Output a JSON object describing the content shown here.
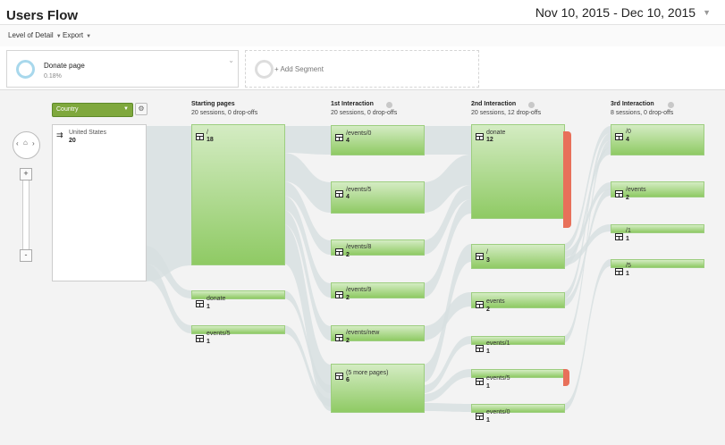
{
  "title": "Users Flow",
  "date_range": {
    "start": "Nov 10, 2015",
    "sep": " - ",
    "end": "Dec 10, 2015"
  },
  "toolbar": {
    "level_of_detail": "Level of Detail",
    "export": "Export"
  },
  "segments": {
    "segment1": {
      "name": "Donate page",
      "percent": "0.18%"
    },
    "add_segment": "+ Add Segment"
  },
  "dimension": {
    "selected": "Country"
  },
  "country_node": {
    "label": "United States",
    "count": "20"
  },
  "columns": [
    {
      "title": "Starting pages",
      "sub": "20 sessions, 0 drop-offs"
    },
    {
      "title": "1st Interaction",
      "sub": "20 sessions, 0 drop-offs"
    },
    {
      "title": "2nd Interaction",
      "sub": "20 sessions, 12 drop-offs"
    },
    {
      "title": "3rd Interaction",
      "sub": "8 sessions, 0 drop-offs"
    }
  ],
  "nodes": {
    "start": [
      {
        "label": "/",
        "count": "18"
      },
      {
        "label": "donate",
        "count": "1"
      },
      {
        "label": "events/5",
        "count": "1"
      }
    ],
    "first": [
      {
        "label": "/events/0",
        "count": "4"
      },
      {
        "label": "/events/5",
        "count": "4"
      },
      {
        "label": "/events/8",
        "count": "2"
      },
      {
        "label": "/events/9",
        "count": "2"
      },
      {
        "label": "/events/new",
        "count": "2"
      },
      {
        "label": "(5 more pages)",
        "count": "6"
      }
    ],
    "second": [
      {
        "label": "donate",
        "count": "12"
      },
      {
        "label": "/",
        "count": "3"
      },
      {
        "label": "events",
        "count": "2"
      },
      {
        "label": "events/1",
        "count": "1"
      },
      {
        "label": "events/5",
        "count": "1"
      },
      {
        "label": "events/0",
        "count": "1"
      }
    ],
    "third": [
      {
        "label": "/0",
        "count": "4"
      },
      {
        "label": "/events",
        "count": "2"
      },
      {
        "label": "/1",
        "count": "1"
      },
      {
        "label": "/5",
        "count": "1"
      }
    ]
  },
  "colors": {
    "node_green": "#8fca64",
    "dropoff_red": "#e8705a",
    "flow_grey": "#d7dfe0",
    "accent_blue": "#a8d8ec"
  }
}
